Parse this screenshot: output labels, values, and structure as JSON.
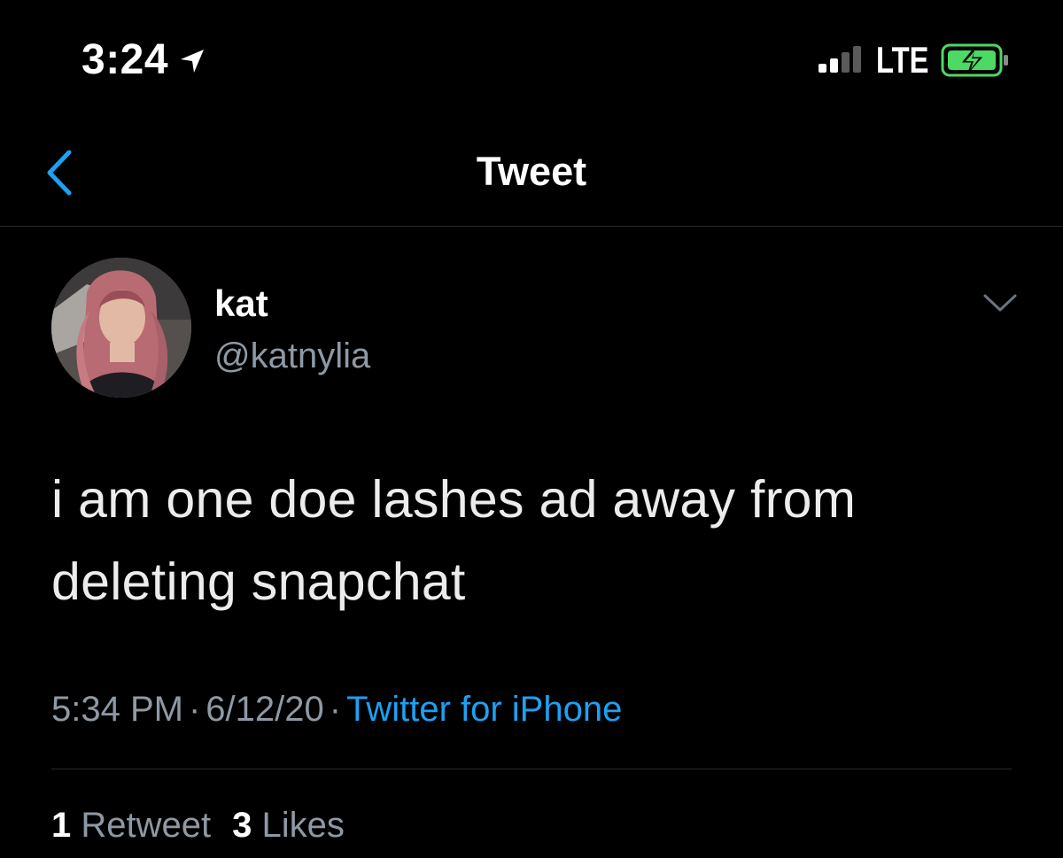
{
  "status_bar": {
    "time": "3:24",
    "network": "LTE",
    "icons": [
      "location-arrow-icon",
      "signal-bars-icon",
      "battery-charging-icon"
    ]
  },
  "nav": {
    "title": "Tweet",
    "back_icon": "chevron-left-icon"
  },
  "tweet": {
    "author": {
      "display_name": "kat",
      "handle": "@katnylia"
    },
    "text": "i am one doe lashes ad away from deleting snapchat",
    "timestamp_time": "5:34 PM",
    "separator": "·",
    "timestamp_date": "6/12/20",
    "source": "Twitter for iPhone",
    "stats": {
      "retweets_count": "1",
      "retweets_label": "Retweet",
      "likes_count": "3",
      "likes_label": "Likes"
    }
  },
  "colors": {
    "background": "#000000",
    "text": "#ffffff",
    "secondary_text": "#8e99a4",
    "accent": "#1da1f2",
    "battery": "#4cd964"
  }
}
